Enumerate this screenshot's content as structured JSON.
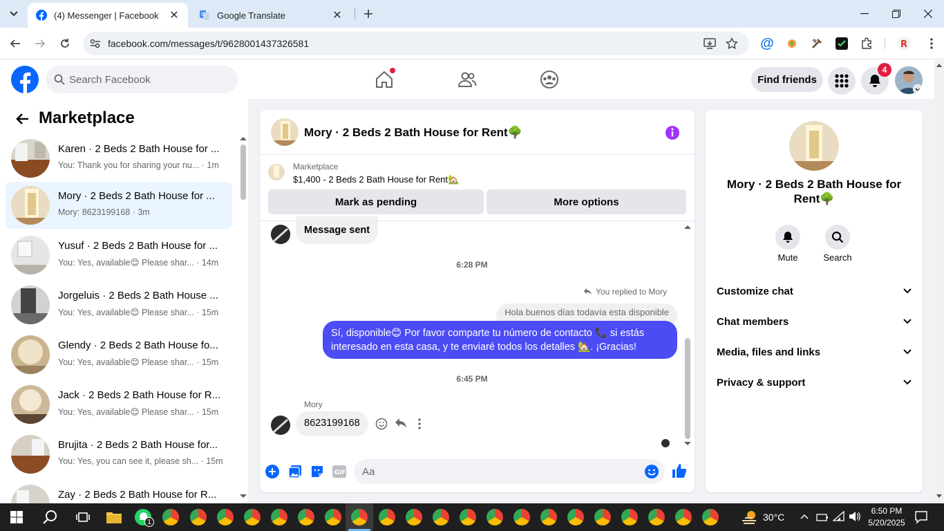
{
  "browser": {
    "tabs": [
      {
        "title": "(4) Messenger | Facebook",
        "active": true
      },
      {
        "title": "Google Translate",
        "active": false
      }
    ],
    "url": "facebook.com/messages/t/9628001437326581"
  },
  "fb": {
    "search_placeholder": "Search Facebook",
    "find_friends": "Find friends",
    "notification_count": "4",
    "brand_color": "#0866ff"
  },
  "sidebar": {
    "title": "Marketplace",
    "items": [
      {
        "name": "Karen · 2 Beds 2 Bath House for ...",
        "preview": "You: Thank you for sharing your nu...",
        "time": "1m",
        "selected": false
      },
      {
        "name": "Mory · 2 Beds 2 Bath House for ...",
        "preview": "Mory: 8623199168",
        "time": "3m",
        "selected": true
      },
      {
        "name": "Yusuf · 2 Beds 2 Bath House for ...",
        "preview": "You: Yes, available😊 Please shar...",
        "time": "14m",
        "selected": false
      },
      {
        "name": "Jorgeluis · 2 Beds 2 Bath House ...",
        "preview": "You: Yes, available😊 Please shar...",
        "time": "15m",
        "selected": false
      },
      {
        "name": "Glendy · 2 Beds 2 Bath House fo...",
        "preview": "You: Yes, available😊 Please shar...",
        "time": "15m",
        "selected": false
      },
      {
        "name": "Jack · 2 Beds 2 Bath House for R...",
        "preview": "You: Yes, available😊 Please shar...",
        "time": "15m",
        "selected": false
      },
      {
        "name": "Brujita · 2 Beds 2 Bath House for...",
        "preview": "You: Yes, you can see it, please sh...",
        "time": "15m",
        "selected": false
      },
      {
        "name": "Zay · 2 Beds 2 Bath House for R...",
        "preview": "",
        "time": "",
        "selected": false
      }
    ]
  },
  "chat": {
    "title": "Mory · 2 Beds 2 Bath House for Rent🌳",
    "marketplace_label": "Marketplace",
    "listing": "$1,400 - 2 Beds 2 Bath House for Rent🏡",
    "mark_pending": "Mark as pending",
    "more_options": "More options",
    "msg_sent": "Message sent",
    "time1": "6:28 PM",
    "replied_to": "You replied to Mory",
    "quoted": "Hola buenos días todavía esta disponible",
    "outgoing_line1": "Sí, disponible😊 Por favor comparte tu número de contacto 📞 si estás",
    "outgoing_line2": "interesado en esta casa, y te enviaré todos los detalles 🏡. ¡Gracias!",
    "time2": "6:45 PM",
    "sender": "Mory",
    "incoming": "8623199168",
    "composer_placeholder": "Aa"
  },
  "info": {
    "title_line1": "Mory · 2 Beds 2 Bath House for",
    "title_line2": "Rent🌳",
    "mute": "Mute",
    "search": "Search",
    "sections": [
      "Customize chat",
      "Chat members",
      "Media, files and links",
      "Privacy & support"
    ]
  },
  "taskbar": {
    "weather": "30°C",
    "time": "6:50 PM",
    "date": "5/20/2025",
    "whatsapp_badge": "1"
  }
}
